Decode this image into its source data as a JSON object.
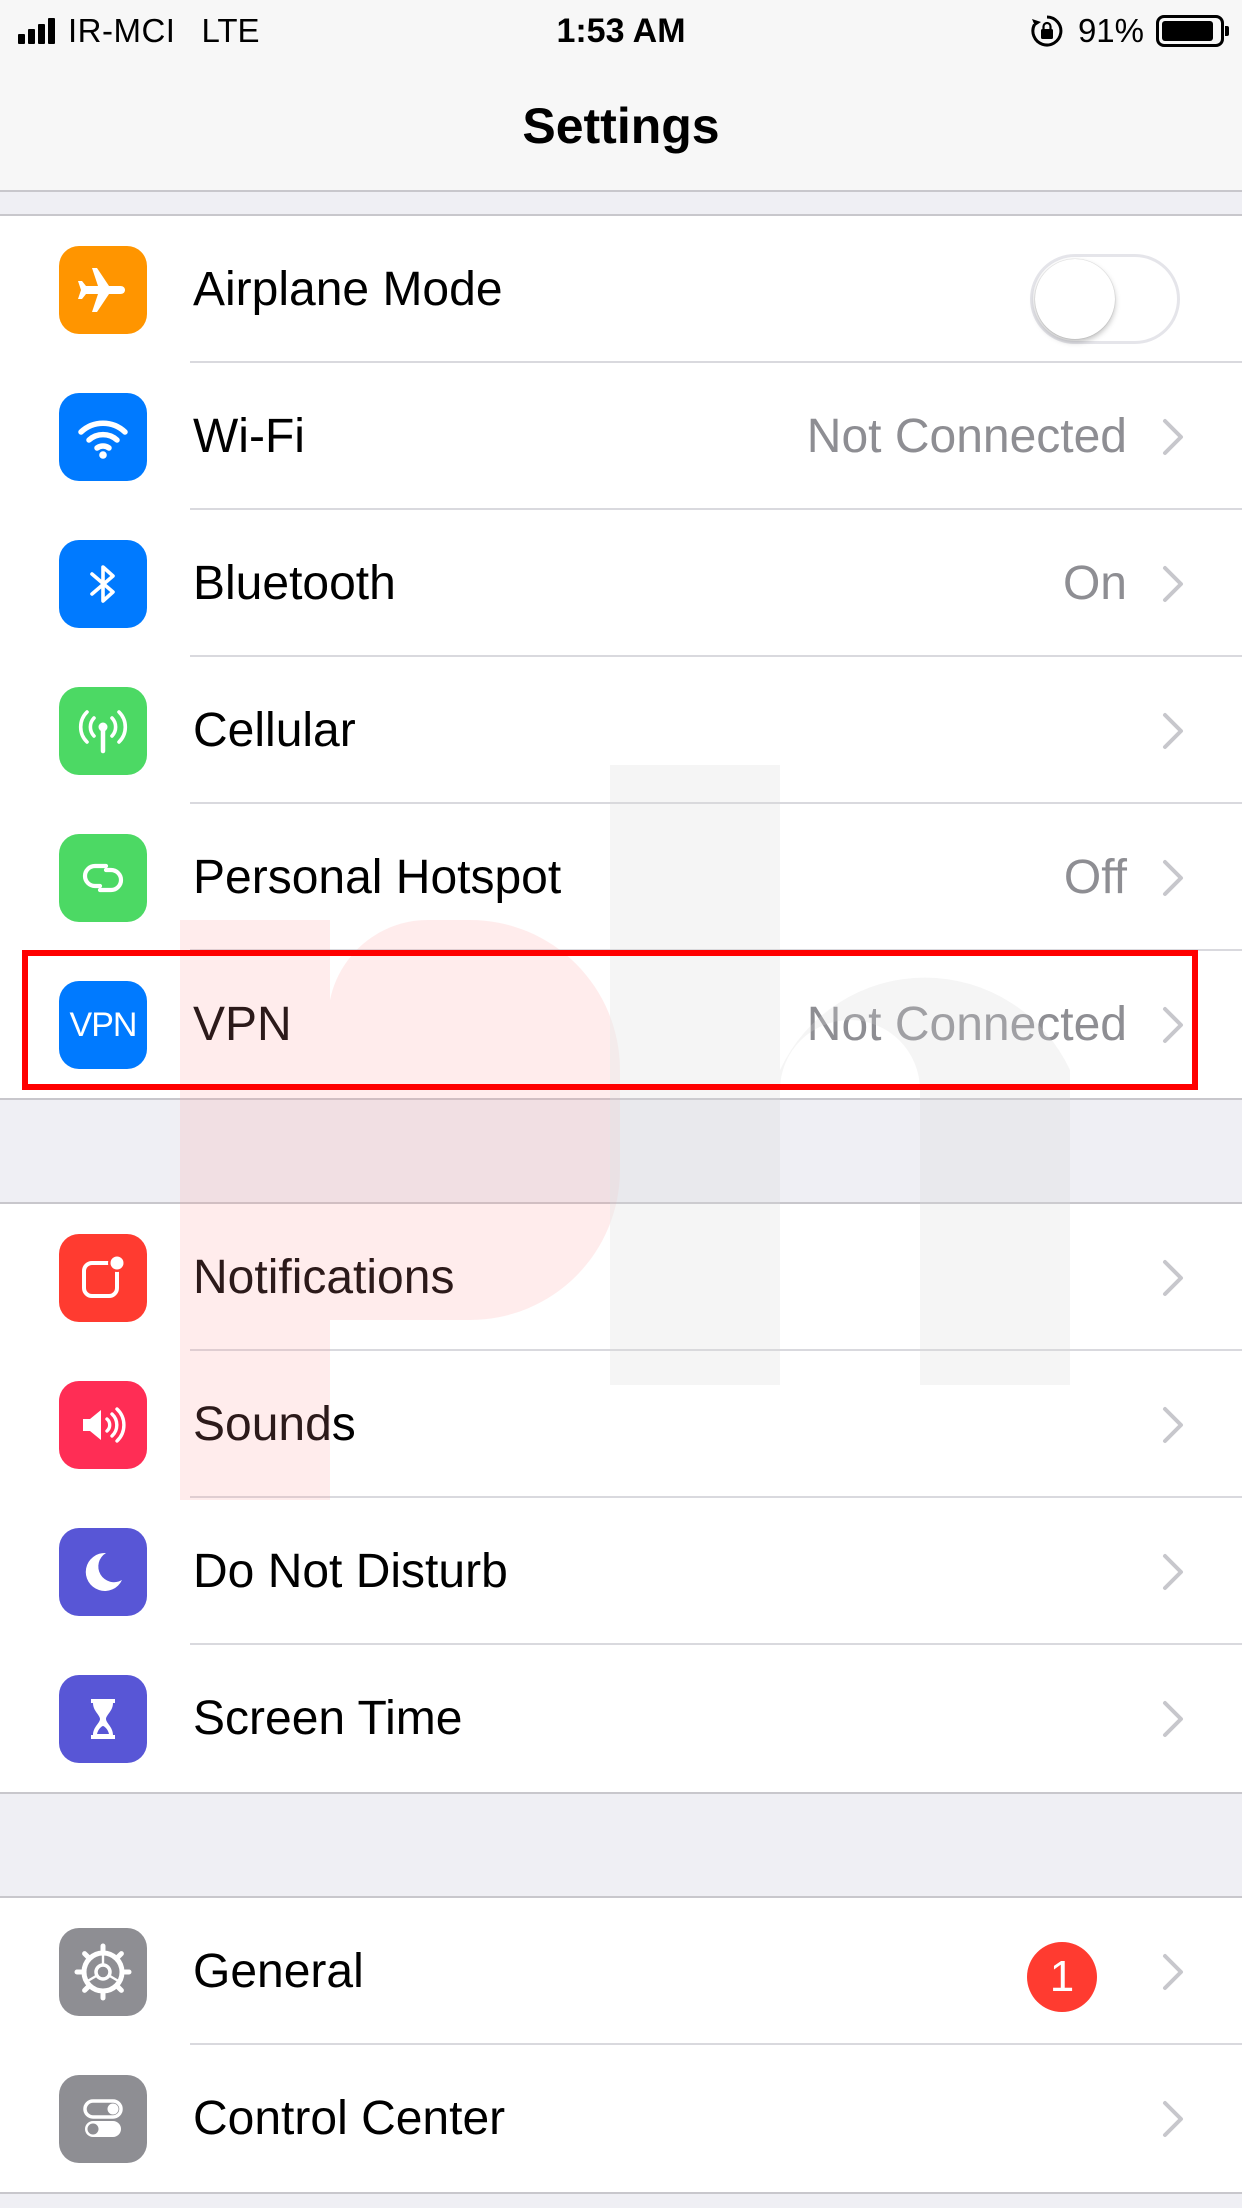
{
  "status_bar": {
    "carrier": "IR-MCI",
    "network": "LTE",
    "time": "1:53 AM",
    "battery_percent": "91%",
    "battery_level": 0.91
  },
  "nav": {
    "title": "Settings"
  },
  "colors": {
    "orange": "#ff9500",
    "blue": "#007aff",
    "green": "#4cd964",
    "red": "#ff3b30",
    "pink": "#ff2d55",
    "indigo": "#5856d6",
    "gray": "#8e8e93",
    "highlight": "#ff0000"
  },
  "groups": [
    {
      "rows": [
        {
          "label": "Airplane Mode",
          "icon": "airplane-icon",
          "toggle": false
        },
        {
          "label": "Wi-Fi",
          "icon": "wifi-icon",
          "value": "Not Connected"
        },
        {
          "label": "Bluetooth",
          "icon": "bluetooth-icon",
          "value": "On"
        },
        {
          "label": "Cellular",
          "icon": "cellular-antenna-icon"
        },
        {
          "label": "Personal Hotspot",
          "icon": "hotspot-link-icon",
          "value": "Off"
        },
        {
          "label": "VPN",
          "icon": "vpn-icon",
          "icon_text": "VPN",
          "value": "Not Connected",
          "highlighted": true
        }
      ]
    },
    {
      "rows": [
        {
          "label": "Notifications",
          "icon": "notifications-icon"
        },
        {
          "label": "Sounds",
          "icon": "speaker-icon"
        },
        {
          "label": "Do Not Disturb",
          "icon": "moon-icon"
        },
        {
          "label": "Screen Time",
          "icon": "hourglass-icon"
        }
      ]
    },
    {
      "rows": [
        {
          "label": "General",
          "icon": "gear-icon",
          "badge": "1"
        },
        {
          "label": "Control Center",
          "icon": "switches-icon"
        }
      ]
    }
  ]
}
